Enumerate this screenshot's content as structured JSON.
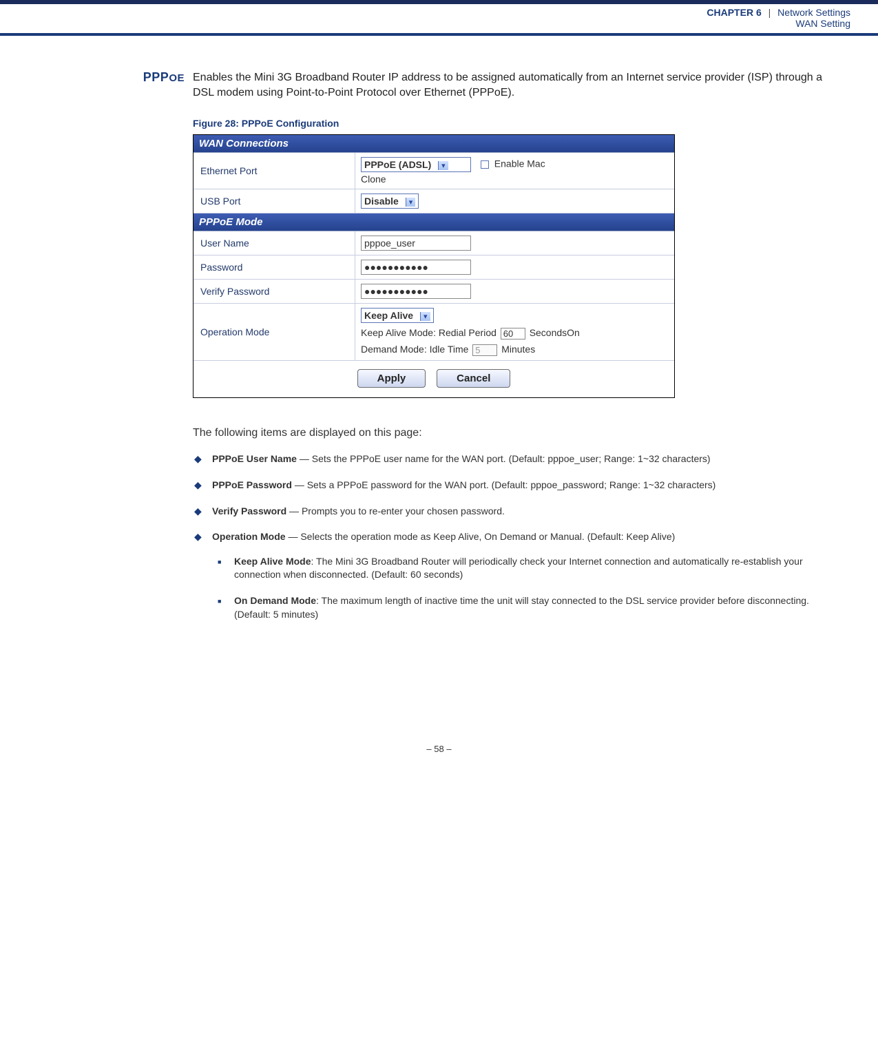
{
  "header": {
    "chapter_label": "CHAPTER 6",
    "separator": " | ",
    "chapter_title": "Network Settings",
    "subtitle": "WAN Setting"
  },
  "section": {
    "title_main": "PPP",
    "title_suffix": "OE",
    "intro": "Enables the Mini 3G Broadband Router IP address to be assigned automatically from an Internet service provider (ISP) through a DSL modem using Point-to-Point Protocol over Ethernet (PPPoE).",
    "figure_caption": "Figure 28:  PPPoE Configuration"
  },
  "screenshot": {
    "header_wan": "WAN Connections",
    "rows": {
      "ethernet_port": {
        "label": "Ethernet Port",
        "select": "PPPoE (ADSL)",
        "checkbox_label": "Enable Mac",
        "clone_line": "Clone"
      },
      "usb_port": {
        "label": "USB Port",
        "select": "Disable"
      }
    },
    "header_pppoe": "PPPoE Mode",
    "pppoe": {
      "user_name": {
        "label": "User Name",
        "value": "pppoe_user"
      },
      "password": {
        "label": "Password",
        "value": "●●●●●●●●●●●"
      },
      "verify": {
        "label": "Verify Password",
        "value": "●●●●●●●●●●●"
      },
      "op_mode": {
        "label": "Operation Mode",
        "select": "Keep Alive",
        "keep_alive_prefix": "Keep Alive Mode: Redial Period",
        "keep_alive_value": "60",
        "keep_alive_suffix": "SecondsOn",
        "demand_prefix": "Demand Mode: Idle Time",
        "demand_value": "5",
        "demand_suffix": "Minutes"
      }
    },
    "buttons": {
      "apply": "Apply",
      "cancel": "Cancel"
    }
  },
  "body": {
    "lead": "The following items are displayed on this page:",
    "items": [
      {
        "term": "PPPoE User Name",
        "text": " — Sets the PPPoE user name for the WAN port. (Default: pppoe_user; Range: 1~32 characters)"
      },
      {
        "term": "PPPoE Password",
        "text": " — Sets a PPPoE password for the WAN port. (Default: pppoe_password; Range: 1~32 characters)"
      },
      {
        "term": "Verify Password",
        "text": " — Prompts you to re-enter your chosen password."
      },
      {
        "term": "Operation Mode",
        "text": " — Selects the operation mode as Keep Alive, On Demand or Manual. (Default: Keep Alive)",
        "sub": [
          {
            "term": "Keep Alive Mode",
            "text": ": The Mini 3G Broadband Router will periodically check your Internet connection and automatically re-establish your connection when disconnected. (Default: 60 seconds)"
          },
          {
            "term": "On Demand Mode",
            "text": ": The maximum length of inactive time the unit will stay connected to the DSL service provider before disconnecting. (Default: 5 minutes)"
          }
        ]
      }
    ]
  },
  "footer": {
    "page": "–  58  –"
  }
}
